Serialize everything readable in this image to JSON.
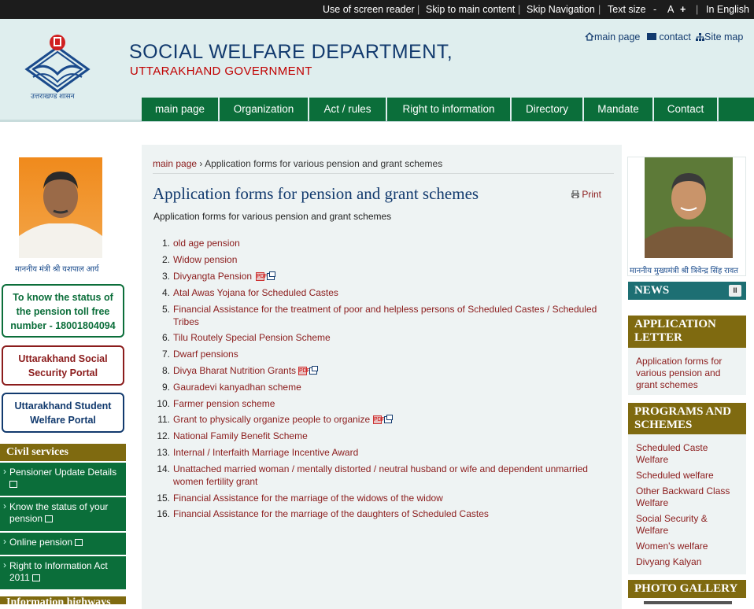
{
  "topbar": {
    "screen_reader": "Use of screen reader",
    "skip_main": "Skip to main content",
    "skip_nav": "Skip Navigation",
    "text_size": "Text size",
    "minus": "-",
    "a": "A",
    "plus": "+",
    "language": "In English",
    "sep": "|"
  },
  "header": {
    "logo_text": "उत्तराखण्ड शासन",
    "title": "SOCIAL WELFARE DEPARTMENT,",
    "subtitle": "UTTARAKHAND GOVERNMENT",
    "links": {
      "home": "main page",
      "contact": "contact",
      "sitemap": "Site map"
    }
  },
  "nav": [
    "main page",
    "Organization",
    "Act / rules",
    "Right to information",
    "Directory",
    "Mandate",
    "Contact"
  ],
  "left": {
    "minister_caption": "माननीय मंत्री श्री यशपाल आर्य",
    "toll_free": "To know the status of the pension toll free number - 18001804094",
    "social_portal": "Uttarakhand Social Security Portal",
    "student_portal": "Uttarakhand Student Welfare Portal",
    "civil_title": "Civil services",
    "civil_items": [
      "Pensioner Update Details",
      "Know the status of your pension",
      "Online pension",
      "Right to Information Act 2011"
    ],
    "next_title": "Information highways"
  },
  "main": {
    "breadcrumb_home": "main page",
    "breadcrumb_sep": "›",
    "breadcrumb_current": "Application forms for various pension and grant schemes",
    "title": "Application forms for pension and grant schemes",
    "print": "Print",
    "subtitle": "Application forms for various pension and grant schemes",
    "items": [
      "old age pension",
      "Widow pension",
      "Divyangta Pension",
      "Atal Awas Yojana for Scheduled Castes",
      "Financial Assistance for the treatment of poor and helpless persons of Scheduled Castes / Scheduled Tribes",
      "Tilu Routely Special Pension Scheme",
      "Dwarf pensions",
      "Divya Bharat Nutrition Grants",
      "Gauradevi kanyadhan scheme",
      "Farmer pension scheme",
      "Grant to physically organize people to organize",
      "National Family Benefit Scheme",
      "Internal / Interfaith Marriage Incentive Award",
      "Unattached married woman / mentally distorted / neutral husband or wife and dependent unmarried women fertility grant",
      "Financial Assistance for the marriage of the widows of the widow",
      "Financial Assistance for the marriage of the daughters of Scheduled Castes"
    ]
  },
  "right": {
    "cm_caption": "माननीय मुख्यमंत्री श्री त्रिवेन्द्र सिंह रावत",
    "news": "NEWS",
    "pause": "II",
    "application_title": "APPLICATION LETTER",
    "application_link": "Application forms for various pension and grant schemes",
    "programs_title": "PROGRAMS AND SCHEMES",
    "programs": [
      "Scheduled Caste Welfare",
      "Scheduled welfare",
      "Other Backward Class Welfare",
      "Social Security & Welfare",
      "Women's welfare",
      "Divyang Kalyan"
    ],
    "gallery": "PHOTO GALLERY"
  },
  "colors": {
    "nav_green": "#0b6e3a",
    "gold": "#7f6a10",
    "teal": "#1d6f73",
    "link_red": "#8b1c1c",
    "navy": "#123a6e"
  }
}
